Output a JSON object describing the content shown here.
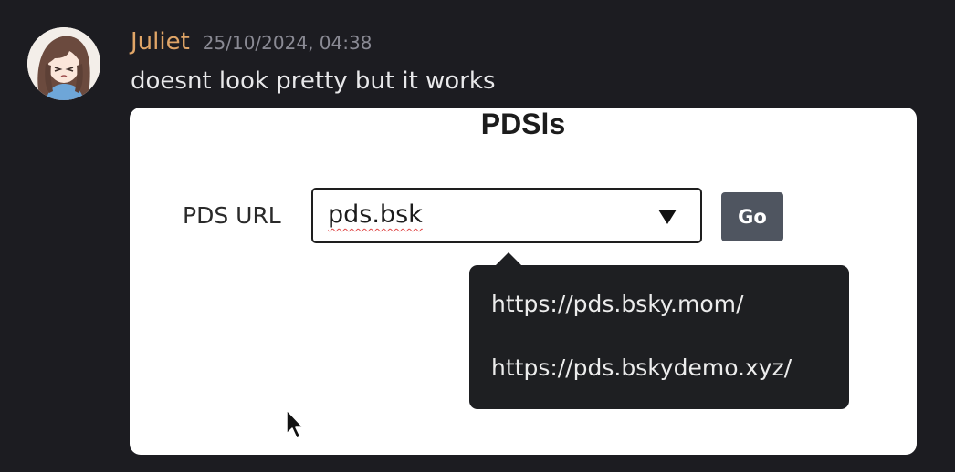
{
  "message": {
    "author": "Juliet",
    "timestamp": "25/10/2024, 04:38",
    "text": "doesnt look pretty but it works",
    "avatar_icon": "anime-avatar"
  },
  "attachment": {
    "app_title": "PDSls",
    "field_label": "PDS URL",
    "input_value": "pds.bsk",
    "go_label": "Go",
    "suggestions": [
      "https://pds.bsky.mom/",
      "https://pds.bskydemo.xyz/"
    ],
    "colors": {
      "go_button": "#4f5560",
      "dropdown_bg": "#1e1f22",
      "spell_underline": "#e04848"
    }
  },
  "colors": {
    "background": "#1c1c21",
    "author": "#e0a567",
    "timestamp": "#8a8a94",
    "message_text": "#e8e8ea"
  }
}
